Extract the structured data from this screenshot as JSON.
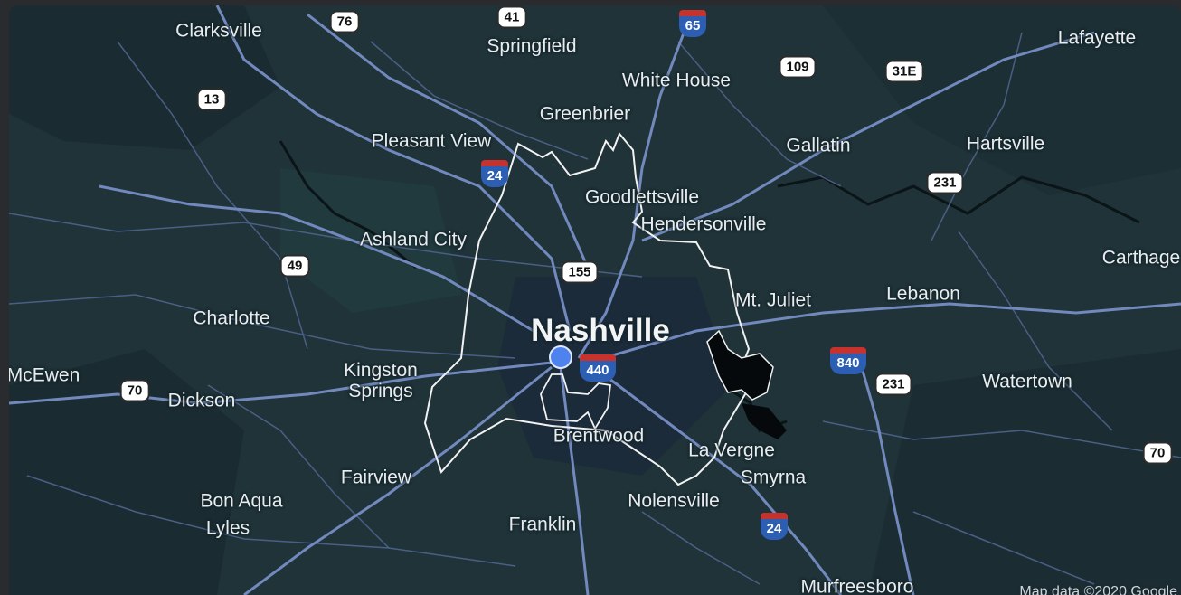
{
  "map": {
    "city_labels": {
      "clarksville": "Clarksville",
      "springfield": "Springfield",
      "lafayette": "Lafayette",
      "white_house": "White House",
      "greenbrier": "Greenbrier",
      "pleasant_view": "Pleasant View",
      "gallatin": "Gallatin",
      "hartsville": "Hartsville",
      "goodlettsville": "Goodlettsville",
      "hendersonville": "Hendersonville",
      "ashland_city": "Ashland City",
      "carthage": "Carthage",
      "mt_juliet": "Mt. Juliet",
      "lebanon": "Lebanon",
      "charlotte": "Charlotte",
      "nashville": "Nashville",
      "mcewen": "McEwen",
      "kingston_springs": "Kingston Springs",
      "dickson": "Dickson",
      "watertown": "Watertown",
      "brentwood": "Brentwood",
      "la_vergne": "La Vergne",
      "smyrna": "Smyrna",
      "fairview": "Fairview",
      "nolensville": "Nolensville",
      "bon_aqua": "Bon Aqua",
      "lyles": "Lyles",
      "franklin": "Franklin",
      "murfreesboro": "Murfreesboro"
    },
    "route_shields": {
      "us_76": "76",
      "us_41": "41",
      "us_109": "109",
      "us_31e": "31E",
      "us_13": "13",
      "us_231_north": "231",
      "us_49": "49",
      "us_155": "155",
      "us_70_west": "70",
      "us_231_south": "231",
      "us_70_east": "70"
    },
    "interstate_shields": {
      "i_65": "65",
      "i_24_north": "24",
      "i_440": "440",
      "i_840": "840",
      "i_24_south": "24"
    },
    "attribution": "Map data ©2020 Google",
    "colors": {
      "background": "#1f3338",
      "roads": "#6f86b8",
      "boundary": "#ffffff",
      "marker": "#4e82ee"
    }
  }
}
